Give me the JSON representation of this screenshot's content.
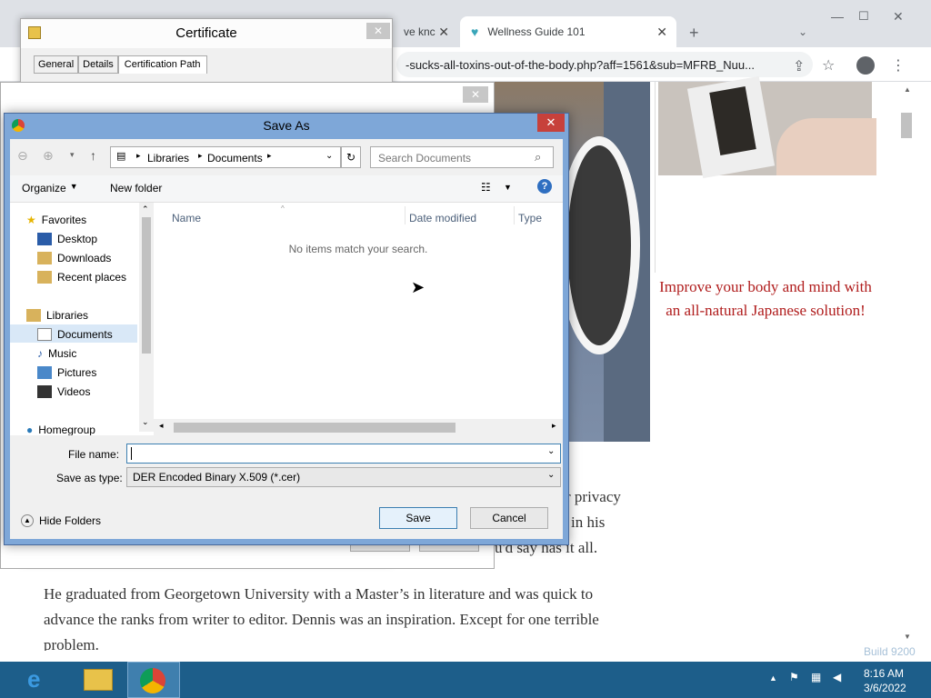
{
  "browser": {
    "tabs": [
      {
        "label": "ve knc",
        "active": false
      },
      {
        "label": "Wellness Guide 101",
        "active": true
      }
    ],
    "url": "-sucks-all-toxins-out-of-the-body.php?aff=1561&sub=MFRB_Nuu..."
  },
  "page": {
    "promo_text": "Improve your body and mind with an all-natural Japanese solution!",
    "partial_lines": [
      "r privacy",
      "in his",
      "u'd say has it all."
    ],
    "body_text": "He graduated from Georgetown University with a Master’s in literature and was quick to advance the ranks from writer to editor. Dennis was an inspiration. Except for one terrible problem."
  },
  "certificate": {
    "title": "Certificate",
    "tabs": [
      "General",
      "Details",
      "Certification Path"
    ]
  },
  "save_as": {
    "title": "Save As",
    "breadcrumb": [
      "Libraries",
      "Documents"
    ],
    "search_placeholder": "Search Documents",
    "organize_label": "Organize",
    "new_folder_label": "New folder",
    "columns": [
      "Name",
      "Date modified",
      "Type"
    ],
    "empty_message": "No items match your search.",
    "nav": {
      "favorites": "Favorites",
      "favorites_items": [
        "Desktop",
        "Downloads",
        "Recent places"
      ],
      "libraries": "Libraries",
      "libraries_items": [
        "Documents",
        "Music",
        "Pictures",
        "Videos"
      ],
      "homegroup": "Homegroup"
    },
    "file_name_label": "File name:",
    "file_name_value": "",
    "save_type_label": "Save as type:",
    "save_type_value": "DER Encoded Binary X.509 (*.cer)",
    "hide_folders_label": "Hide Folders",
    "save_label": "Save",
    "cancel_label": "Cancel"
  },
  "taskbar": {
    "time": "8:16 AM",
    "date": "3/6/2022",
    "watermark": "Build 9200"
  }
}
